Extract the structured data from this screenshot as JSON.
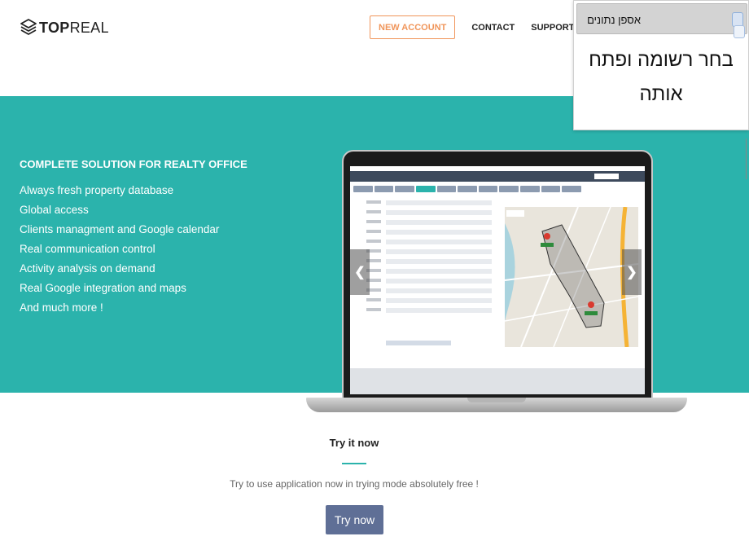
{
  "header": {
    "logo": {
      "bold": "TOP",
      "regular": "REAL"
    },
    "nav": {
      "new_account": "NEW ACCOUNT",
      "contact": "CONTACT",
      "support": "SUPPORT",
      "partial": "S"
    }
  },
  "hero": {
    "title": "COMPLETE SOLUTION FOR REALTY OFFICE",
    "features": [
      "Always fresh property database",
      "Global access",
      "Clients managment and Google calendar",
      "Real communication control",
      "Activity analysis on demand",
      "Real Google integration and maps",
      "And much more !"
    ],
    "carousel": {
      "prev": "❮",
      "next": "❯"
    }
  },
  "try_section": {
    "title": "Try it now",
    "description": "Try to use application now in trying mode absolutely free !",
    "button": "Try now"
  },
  "popup": {
    "header": "אספן נתונים",
    "body": "בחר רשומה ופתח אותה"
  },
  "colors": {
    "teal": "#2bb3ac",
    "orange": "#f0955a",
    "button_blue": "#5f6f96"
  }
}
